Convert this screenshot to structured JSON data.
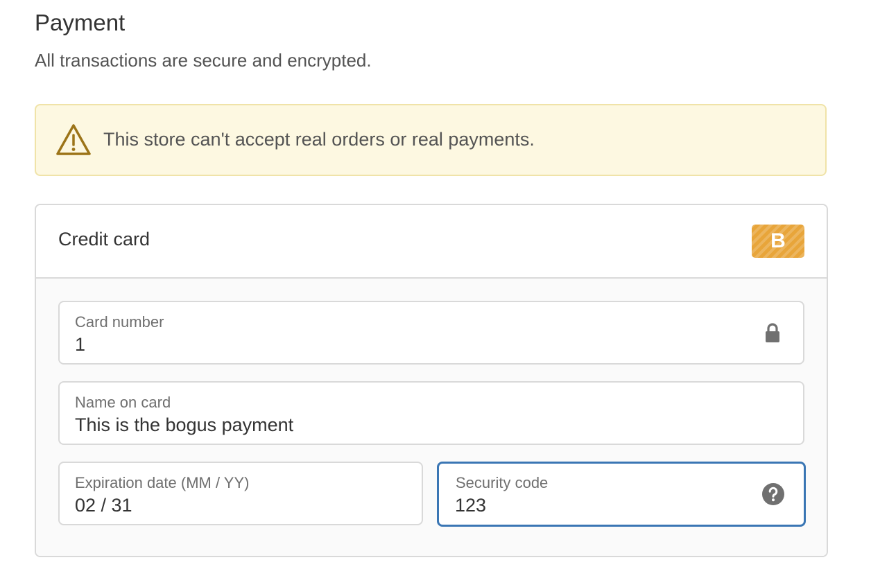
{
  "payment": {
    "title": "Payment",
    "subtitle": "All transactions are secure and encrypted."
  },
  "warning": {
    "icon": "warning-triangle-icon",
    "text": "This store can't accept real orders or real payments.",
    "background_color": "#fdf8e1",
    "border_color": "#f0e3a8"
  },
  "credit_card": {
    "title": "Credit card",
    "brand_badge": "B",
    "brand_color": "#e8a53a",
    "fields": {
      "card_number": {
        "label": "Card number",
        "value": "1",
        "icon": "lock-icon"
      },
      "name_on_card": {
        "label": "Name on card",
        "value": "This is the bogus payment"
      },
      "expiration_date": {
        "label": "Expiration date (MM / YY)",
        "value": "02 / 31"
      },
      "security_code": {
        "label": "Security code",
        "value": "123",
        "icon": "help-icon",
        "focused": true
      }
    },
    "focus_color": "#3a76b4"
  }
}
